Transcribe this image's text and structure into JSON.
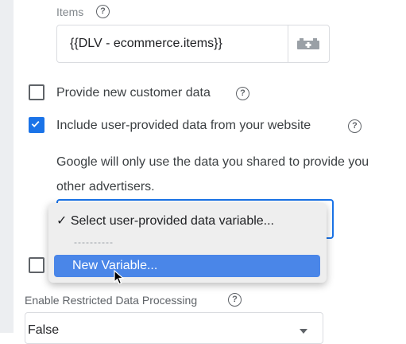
{
  "items": {
    "label": "Items",
    "value": "{{DLV - ecommerce.items}}",
    "help_icon": "help-circle-icon",
    "picker_icon": "variable-picker-icon"
  },
  "checkboxes": [
    {
      "label": "Provide new customer data",
      "checked": false
    },
    {
      "label": "Include user-provided data from your website",
      "checked": true
    }
  ],
  "description": "Google will only use the data you shared to provide you services, including technical support. Google won't share your data with other advertisers.",
  "description_visible_line1": "Google will only use the data you shared to provide you",
  "description_visible_line2": "other advertisers.",
  "dropdown": {
    "options": [
      {
        "label": "Select user-provided data variable...",
        "selected": true,
        "checkmark": "✓"
      },
      {
        "label": "----------",
        "separator": true
      },
      {
        "label": "New Variable...",
        "highlighted": true
      }
    ]
  },
  "restricted": {
    "label": "Enable Restricted Data Processing",
    "value": "False"
  },
  "colors": {
    "accent": "#1a73e8",
    "highlight": "#4a86e8"
  }
}
